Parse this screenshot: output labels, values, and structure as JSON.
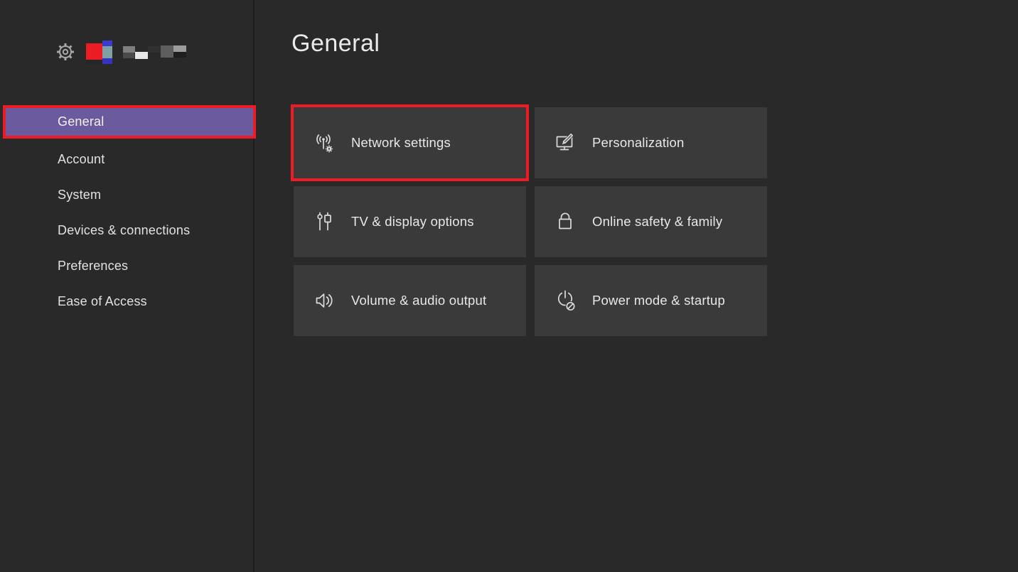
{
  "app": {
    "name": "xbox-settings"
  },
  "colors": {
    "background": "#292929",
    "tile_background": "#3A3A3A",
    "selected_purple": "#6B5B9E",
    "annotation_red": "#ED1C24",
    "text": "#E8E8E8"
  },
  "sidebar": {
    "items": [
      {
        "label": "General",
        "selected": true,
        "annotated": true
      },
      {
        "label": "Account",
        "selected": false,
        "annotated": false
      },
      {
        "label": "System",
        "selected": false,
        "annotated": false
      },
      {
        "label": "Devices & connections",
        "selected": false,
        "annotated": false
      },
      {
        "label": "Preferences",
        "selected": false,
        "annotated": false
      },
      {
        "label": "Ease of Access",
        "selected": false,
        "annotated": false
      }
    ]
  },
  "main": {
    "title": "General",
    "tiles": [
      {
        "label": "Network settings",
        "icon": "network-settings-icon",
        "annotated": true
      },
      {
        "label": "Personalization",
        "icon": "personalization-icon",
        "annotated": false
      },
      {
        "label": "TV & display options",
        "icon": "tv-display-icon",
        "annotated": false
      },
      {
        "label": "Online safety & family",
        "icon": "online-safety-icon",
        "annotated": false
      },
      {
        "label": "Volume & audio output",
        "icon": "volume-icon",
        "annotated": false
      },
      {
        "label": "Power mode & startup",
        "icon": "power-mode-icon",
        "annotated": false
      }
    ]
  }
}
